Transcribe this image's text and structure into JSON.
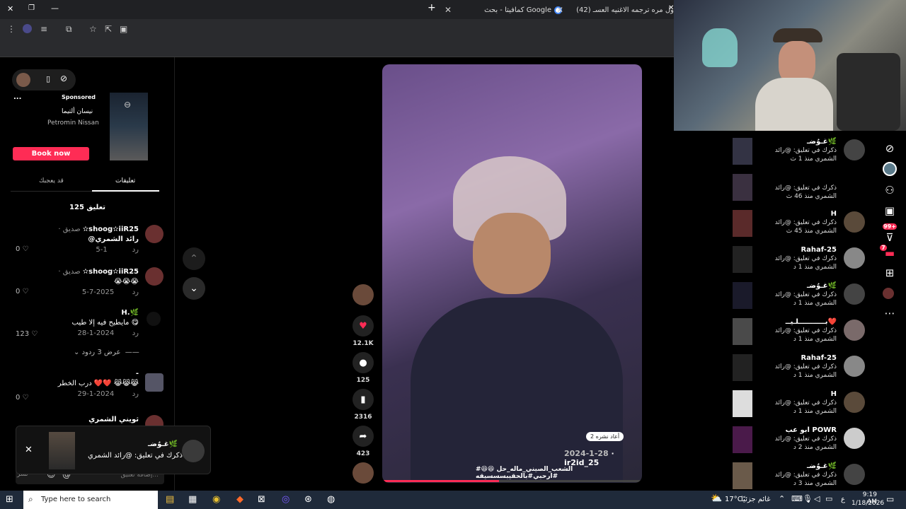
{
  "browser": {
    "tabs": [
      {
        "label": "(42) لاول مره ترجمه الاغنيه العسـ"
      },
      {
        "label": "كمافيتا - بحث Google"
      }
    ],
    "new_tab": "+"
  },
  "left": {
    "ad": {
      "sponsored": "Sponsored",
      "title": "نيسان ألتيما",
      "brand": "Petromin Nissan",
      "cta": "Book now",
      "more": "..."
    },
    "tabs": {
      "comments": "تعليقات",
      "liked": "قد يعجبك"
    },
    "comment_count": "125 تعليق",
    "comments": [
      {
        "name": "✫shoog✫iiR25",
        "tag": "· صديق",
        "text": "@رائد الشمري",
        "date": "1-5",
        "reply": "رد",
        "likes": "0"
      },
      {
        "name": "✫shoog✫iiR25",
        "tag": "· صديق",
        "text": "😭😭😭",
        "date": "2025-7-5",
        "reply": "رد",
        "likes": "0"
      },
      {
        "name": "H.🌿",
        "tag": "",
        "text": "مايطيح فيه إلا طيب 😋",
        "date": "2024-1-28",
        "reply": "رد",
        "likes": "123",
        "replies": "عرض 3 ردود"
      },
      {
        "name": "-",
        "tag": "",
        "text": "درب الخطر ❤️❤️ 😹😹😹",
        "date": "2024-1-29",
        "reply": "رد",
        "likes": "0"
      },
      {
        "name": "ثويني الشمري",
        "tag": "",
        "text": "",
        "date": "",
        "reply": "",
        "likes": ""
      }
    ],
    "input_placeholder": "إضافة تعليق...",
    "post_label": "نشر"
  },
  "toast": {
    "name": "غـوُضـ🌿",
    "text": "ذكرك في تعليق: @رائد الشمري",
    "close": "✕"
  },
  "video": {
    "author": "ir2id_25",
    "date": "2024-1-28",
    "caption": "#الشعب_الصيني_ماله_حل 😆😆 #ارحبي#بالحقيبسسسيقه",
    "reposts": "2 أعاد نشره",
    "likes": "12.1K",
    "comments": "125",
    "saves": "2316",
    "shares": "423"
  },
  "notifications": [
    {
      "name": "غـوُضـ🌿",
      "text": "ذكرك في تعليق: @رائد",
      "meta": "الشمري منذ 1 ث"
    },
    {
      "name": "",
      "text": "ذكرك في تعليق: @رائد",
      "meta": "الشمري منذ 46 ث"
    },
    {
      "name": "H",
      "text": "ذكرك في تعليق: @رائد",
      "meta": "الشمري منذ 45 ث"
    },
    {
      "name": "Rahaf-25",
      "text": "ذكرك في تعليق: @رائد",
      "meta": "الشمري منذ 1 د"
    },
    {
      "name": "غـوُضـ🌿",
      "text": "ذكرك في تعليق: @رائد",
      "meta": "الشمري منذ 1 د"
    },
    {
      "name": "بـــــــــــلـيــ❤️",
      "text": "ذكرك في تعليق: @رائد",
      "meta": "الشمري منذ 1 د"
    },
    {
      "name": "Rahaf-25",
      "text": "ذكرك في تعليق: @رائد",
      "meta": "الشمري منذ 1 د"
    },
    {
      "name": "H",
      "text": "ذكرك في تعليق: @رائد",
      "meta": "الشمري منذ 1 د"
    },
    {
      "name": "ابو عب POWR",
      "text": "ذكرك في تعليق: @رائد",
      "meta": "الشمري منذ 2 د"
    },
    {
      "name": "غـوُضـ🌿",
      "text": "ذكرك في تعليق: @رائد",
      "meta": "الشمري منذ 3 د"
    }
  ],
  "rail": {
    "badge1": "99+",
    "badge2": "7"
  },
  "taskbar": {
    "search_placeholder": "Type here to search",
    "weather": "17°C",
    "weather_desc": "غائم جزئيًا",
    "time": "9:19 AM",
    "date": "1/18/2026",
    "lang": "ع"
  }
}
